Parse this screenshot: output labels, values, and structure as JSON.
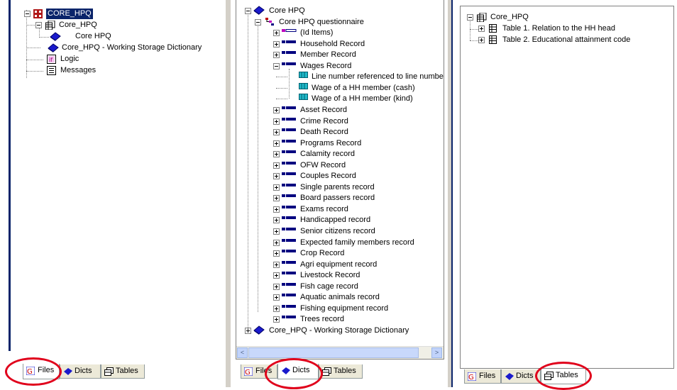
{
  "files_panel": {
    "root": "CORE_HPQ",
    "app_node": "Core_HPQ",
    "dict_node": "Core HPQ",
    "working_storage": "Core_HPQ - Working Storage Dictionary",
    "logic": "Logic",
    "messages": "Messages"
  },
  "dicts_panel": {
    "root": "Core HPQ",
    "questionnaire": "Core HPQ questionnaire",
    "id_items": "(Id Items)",
    "records_before": [
      "Household Record",
      "Member Record"
    ],
    "wages_record": "Wages Record",
    "wages_items": [
      "Line number referenced to line number ir",
      "Wage of a HH member (cash)",
      "Wage of a HH member (kind)"
    ],
    "records_after": [
      "Asset Record",
      "Crime Record",
      "Death Record",
      "Programs Record",
      "Calamity record",
      "OFW Record",
      "Couples Record",
      "Single parents record",
      "Board passers record",
      "Exams record",
      "Handicapped record",
      "Senior citizens record",
      "Expected family members record",
      "Crop Record",
      "Agri equipment record",
      "Livestock Record",
      "Fish cage record",
      "Aquatic animals record",
      "Fishing equipment record",
      "Trees record"
    ],
    "working_storage": "Core_HPQ - Working Storage Dictionary",
    "scroll_left": "<",
    "scroll_right": ">"
  },
  "tables_panel": {
    "root": "Core_HPQ",
    "tables": [
      "Table 1. Relation to the HH head",
      "Table 2. Educational attainment code"
    ]
  },
  "tabs": {
    "files": "Files",
    "dicts": "Dicts",
    "tables": "Tables"
  },
  "colors": {
    "selection": "#0a246a",
    "highlight_circle": "#e0001b",
    "tab_bar": "#ece9d8"
  }
}
